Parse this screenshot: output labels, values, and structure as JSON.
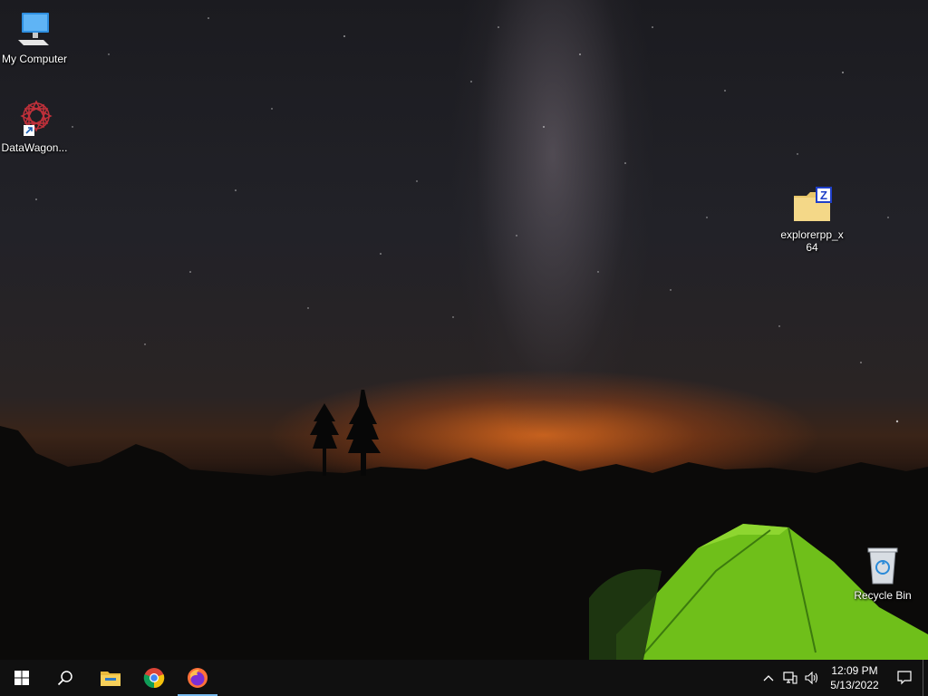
{
  "desktop": {
    "icons": [
      {
        "label": "My Computer",
        "icon": "monitor-icon"
      },
      {
        "label": "DataWagon...",
        "icon": "datawagon-icon"
      },
      {
        "label": "explorerpp_x64",
        "icon": "zip-folder-icon"
      },
      {
        "label": "Recycle Bin",
        "icon": "recycle-bin-icon"
      }
    ]
  },
  "taskbar": {
    "start": "windows-start-icon",
    "search": "search-icon",
    "pinned": [
      "file-explorer-icon",
      "chrome-icon",
      "firefox-icon"
    ],
    "tray": {
      "icons": [
        "chevron-up-icon",
        "network-icon",
        "volume-icon"
      ],
      "time": "12:09 PM",
      "date": "5/13/2022",
      "notification": "notification-icon"
    }
  },
  "colors": {
    "taskbar": "#101010",
    "active_indicator": "#76b9ed"
  }
}
